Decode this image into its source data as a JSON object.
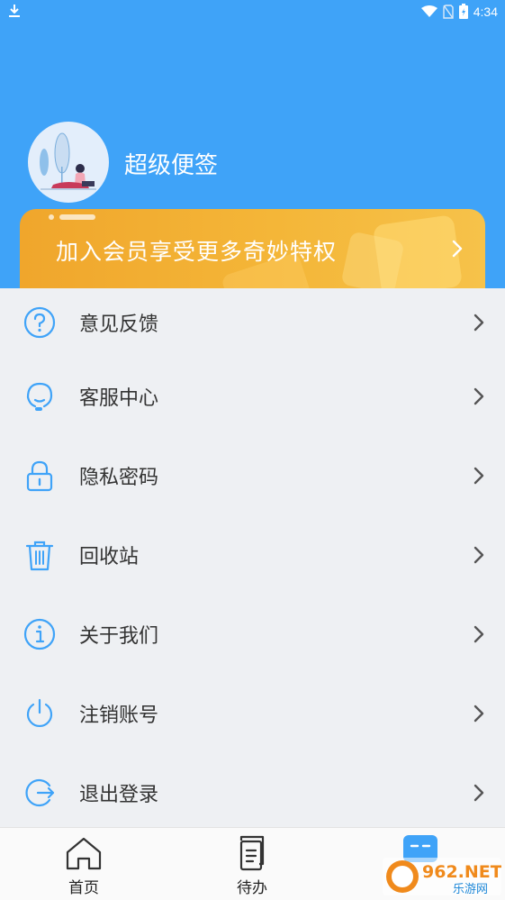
{
  "statusbar": {
    "time": "4:34"
  },
  "profile": {
    "app_name": "超级便签"
  },
  "vip_banner": {
    "text": "加入会员享受更多奇妙特权"
  },
  "menu": {
    "items": [
      {
        "label": "意见反馈",
        "icon": "question-circle-icon"
      },
      {
        "label": "客服中心",
        "icon": "headset-icon"
      },
      {
        "label": "隐私密码",
        "icon": "lock-icon"
      },
      {
        "label": "回收站",
        "icon": "trash-icon"
      },
      {
        "label": "关于我们",
        "icon": "info-circle-icon"
      },
      {
        "label": "注销账号",
        "icon": "power-icon"
      },
      {
        "label": "退出登录",
        "icon": "logout-icon"
      }
    ]
  },
  "tabbar": {
    "tabs": [
      {
        "label": "首页",
        "icon": "home-icon"
      },
      {
        "label": "待办",
        "icon": "todo-list-icon"
      },
      {
        "label": "",
        "icon": "profile-icon"
      }
    ]
  },
  "watermark": {
    "text": "962.NET",
    "subtext": "乐游网"
  },
  "colors": {
    "primary": "#3fa3f8",
    "vip_gold": "#f4b638",
    "icon_blue": "#3fa3f8"
  }
}
